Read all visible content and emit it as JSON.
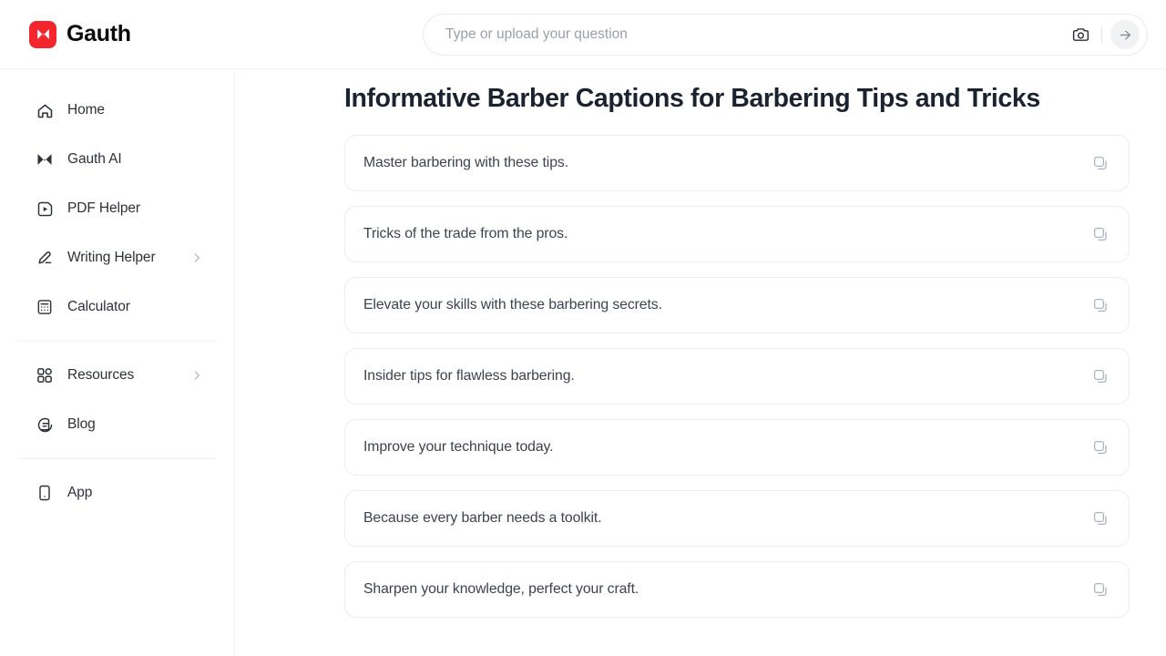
{
  "header": {
    "brand_name": "Gauth",
    "brand_mark_color": "#F5252D",
    "logo_icon": "gauth-x-logo-icon",
    "search": {
      "placeholder": "Type or upload your question",
      "value": "",
      "camera_icon": "camera-icon",
      "submit_icon": "arrow-right-icon"
    }
  },
  "sidebar": {
    "groups": [
      {
        "items": [
          {
            "label": "Home",
            "icon": "home-icon",
            "chevron": false
          },
          {
            "label": "Gauth AI",
            "icon": "gauth-x-icon",
            "chevron": false
          },
          {
            "label": "PDF Helper",
            "icon": "pdf-play-icon",
            "chevron": false
          },
          {
            "label": "Writing Helper",
            "icon": "pencil-icon",
            "chevron": true
          },
          {
            "label": "Calculator",
            "icon": "calculator-icon",
            "chevron": false
          }
        ]
      },
      {
        "items": [
          {
            "label": "Resources",
            "icon": "grid-apps-icon",
            "chevron": true
          },
          {
            "label": "Blog",
            "icon": "blog-bubble-icon",
            "chevron": false
          }
        ]
      },
      {
        "items": [
          {
            "label": "App",
            "icon": "mobile-phone-icon",
            "chevron": false
          }
        ]
      }
    ]
  },
  "main": {
    "title": "Informative Barber Captions for Barbering Tips and Tricks",
    "copy_icon": "copy-icon",
    "captions": [
      "Master barbering with these tips.",
      "Tricks of the trade from the pros.",
      "Elevate your skills with these barbering secrets.",
      "Insider tips for flawless barbering.",
      "Improve your technique today.",
      "Because every barber needs a toolkit.",
      "Sharpen your knowledge, perfect your craft."
    ]
  }
}
